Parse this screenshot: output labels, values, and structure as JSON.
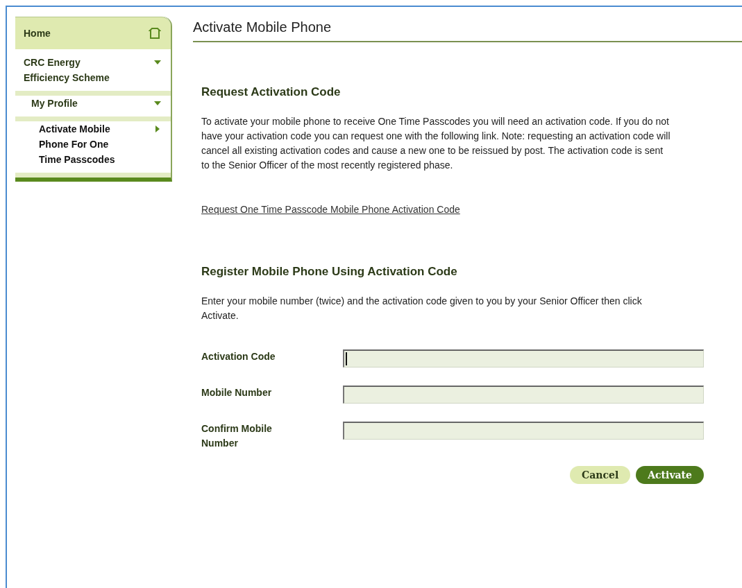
{
  "sidebar": {
    "home": {
      "label": "Home"
    },
    "items": [
      {
        "label": "CRC Energy Efficiency Scheme",
        "expanded": true,
        "selected": false,
        "children": [
          {
            "label": "My Profile",
            "expanded": true,
            "selected": false,
            "children": [
              {
                "label": "Activate Mobile Phone For One Time Passcodes",
                "expanded": false,
                "selected": true
              }
            ]
          }
        ]
      }
    ]
  },
  "page_title": "Activate Mobile Phone",
  "sections": [
    {
      "heading": "Request Activation Code",
      "text": "To activate your mobile phone to receive One Time Passcodes you will need an activation code. If you do not have your activation code you can request one with the following link. Note: requesting an activation code will cancel all existing activation codes and cause a new one to be reissued by post. The activation code is sent to the Senior Officer of the most recently registered phase.",
      "link": "Request One Time Passcode Mobile Phone Activation Code"
    },
    {
      "heading": "Register Mobile Phone Using Activation Code",
      "text": "Enter your mobile number (twice) and the activation code given to you by your Senior Officer then click Activate."
    }
  ],
  "form": {
    "fields": [
      {
        "label": "Activation Code",
        "focused": true
      },
      {
        "label": "Mobile Number",
        "focused": false
      },
      {
        "label": "Confirm Mobile Number",
        "focused": false
      }
    ],
    "buttons": [
      {
        "label": "Cancel",
        "kind": "secondary"
      },
      {
        "label": "Activate",
        "kind": "primary"
      }
    ]
  }
}
